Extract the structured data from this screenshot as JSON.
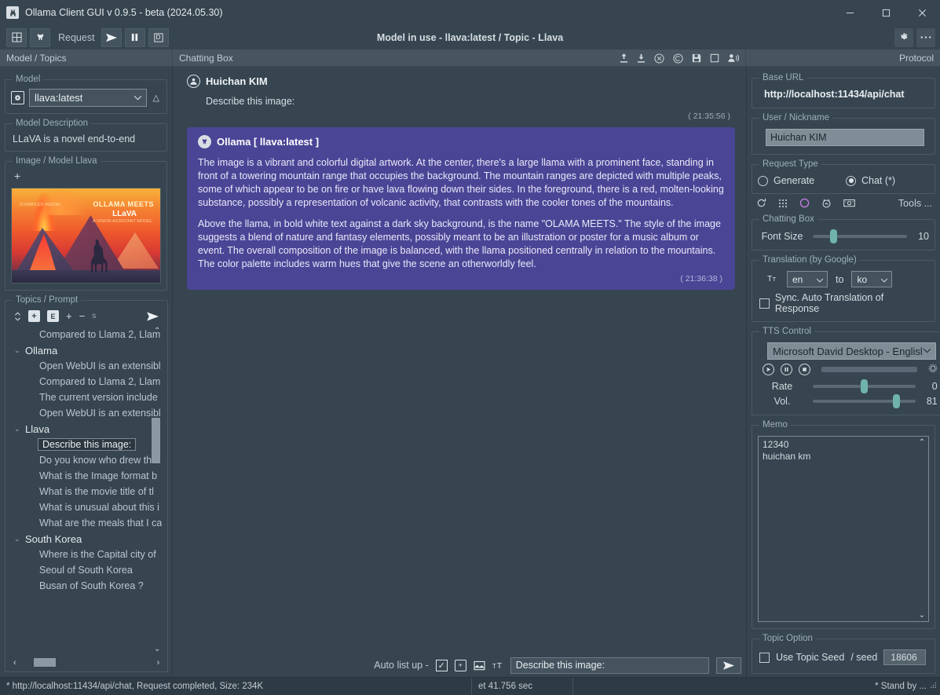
{
  "window": {
    "title": "Ollama Client GUI v 0.9.5 - beta (2024.05.30)",
    "app_icon": "llama-icon",
    "minimize": "−",
    "maximize": "□",
    "close": "✕"
  },
  "toolbar": {
    "grid_button": "grid-icon",
    "llama_button": "llama-icon",
    "request_label": "Request",
    "send_icon": "send-icon",
    "pause_icon": "pause-icon",
    "d_icon": "D",
    "center_title": "Model in use - llava:latest / Topic - Llava",
    "settings_icon": "gear-icon",
    "more_icon": "more-icon"
  },
  "header": {
    "left_label": "Model / Topics",
    "mid_label": "Chatting Box",
    "right_label": "Protocol",
    "mid_icons": [
      "upload-icon",
      "download-icon",
      "clear-icon",
      "copy-icon",
      "save-icon",
      "window-icon",
      "user-speak-icon"
    ]
  },
  "left_panel": {
    "model": {
      "legend": "Model",
      "icon": "model-icon",
      "value": "llava:latest",
      "caret": "⌄",
      "up_icon": "△"
    },
    "model_description": {
      "legend": "Model Description",
      "text": "LLaVA is a novel end-to-end"
    },
    "image": {
      "legend": "Image / Model Llava",
      "add_icon": "+",
      "thumb_title_1": "OLLAMA MEETS",
      "thumb_title_2": "LLaVA",
      "thumb_sub": "A VISION ASSISTANT MODEL",
      "thumb_corner": "(COMPILED INSIDE)"
    },
    "topics": {
      "legend": "Topics / Prompt",
      "buttons": [
        "sort-icon",
        "add-box-icon",
        "edit-box-icon",
        "plus-icon",
        "minus-icon",
        "s-icon",
        "send-icon"
      ],
      "tree": [
        {
          "indent": 1,
          "label": "Compared to Llama 2, Llam",
          "caret": "",
          "selected": false
        },
        {
          "indent": 0,
          "label": "Ollama",
          "caret": "⌄",
          "selected": false
        },
        {
          "indent": 1,
          "label": "Open WebUI is an extensibl",
          "caret": "",
          "selected": false
        },
        {
          "indent": 1,
          "label": "Compared to Llama 2, Llam",
          "caret": "",
          "selected": false
        },
        {
          "indent": 1,
          "label": "The current version include",
          "caret": "",
          "selected": false
        },
        {
          "indent": 1,
          "label": "Open WebUI is an extensibl",
          "caret": "",
          "selected": false
        },
        {
          "indent": 0,
          "label": "Llava",
          "caret": "⌄",
          "selected": false
        },
        {
          "indent": 1,
          "label": "Describe this image:",
          "caret": "",
          "selected": true
        },
        {
          "indent": 1,
          "label": "Do you know who drew this",
          "caret": "",
          "selected": false
        },
        {
          "indent": 1,
          "label": "What is the Image format b",
          "caret": "",
          "selected": false
        },
        {
          "indent": 1,
          "label": "What is the movie title of  tl",
          "caret": "",
          "selected": false
        },
        {
          "indent": 1,
          "label": "What is unusual about this i",
          "caret": "",
          "selected": false
        },
        {
          "indent": 1,
          "label": "What are the meals that I ca",
          "caret": "",
          "selected": false
        },
        {
          "indent": 0,
          "label": "South Korea",
          "caret": "⌄",
          "selected": false
        },
        {
          "indent": 1,
          "label": "Where is the Capital city of",
          "caret": "",
          "selected": false
        },
        {
          "indent": 1,
          "label": "Seoul of South Korea",
          "caret": "",
          "selected": false
        },
        {
          "indent": 1,
          "label": "Busan of South Korea ?",
          "caret": "",
          "selected": false
        }
      ],
      "scroll_up": "⌃",
      "scroll_down": "⌄",
      "hscroll_left": "‹",
      "hscroll_right": "›"
    }
  },
  "chat": {
    "user": {
      "avatar_icon": "user-circle-icon",
      "name": "Huichan KIM",
      "message": "Describe this image:",
      "timestamp": "( 21:35:56 )"
    },
    "assistant": {
      "avatar_icon": "llama-avatar-icon",
      "name": "Ollama [ llava:latest ]",
      "paragraphs": [
        "The image is a vibrant and colorful digital artwork. At the center, there's a large llama with a prominent face, standing in front of a towering mountain range that occupies the background. The mountain ranges are depicted with multiple peaks, some of which appear to be on fire or have lava flowing down their sides. In the foreground, there is a red, molten-looking substance, possibly a representation of volcanic activity, that contrasts with the cooler tones of the mountains.",
        "Above the llama, in bold white text against a dark sky background, is the name \"OLAMA MEETS.\" The style of the image suggests a blend of nature and fantasy elements, possibly meant to be an illustration or poster for a music album or event. The overall composition of the image is balanced, with the llama positioned centrally in relation to the mountains. The color palette includes warm hues that give the scene an otherworldly feel."
      ],
      "timestamp": "( 21:36:38 )",
      "bubble_color": "#4b4596"
    }
  },
  "input_bar": {
    "auto_list_label": "Auto list up  -",
    "checkbox_checked": true,
    "check_glyph": "✓",
    "buttons": [
      "add-image-icon",
      "picture-icon",
      "font-size-icon"
    ],
    "prompt_value": "Describe this image:",
    "prompt_placeholder": "",
    "send_icon": "send-icon"
  },
  "right_panel": {
    "base_url": {
      "legend": "Base URL",
      "value": "http://localhost:11434/api/chat"
    },
    "user_nickname": {
      "legend": "User / Nickname",
      "value": "Huichan KIM"
    },
    "request_type": {
      "legend": "Request Type",
      "options": [
        {
          "label": "Generate",
          "selected": false
        },
        {
          "label": "Chat (*)",
          "selected": true
        }
      ]
    },
    "tools_row": {
      "icons": [
        "refresh-icon",
        "grid-dots-icon",
        "circle-icon",
        "timer-icon",
        "camera-icon"
      ],
      "label": "Tools ...",
      "circle_color": "#c57de0"
    },
    "chatting_box": {
      "legend": "Chatting Box",
      "font_size_label": "Font Size",
      "font_size_value": "10",
      "font_size_percent": 22
    },
    "translation": {
      "legend": "Translation (by Google)",
      "icon": "translate-icon",
      "from": "en",
      "to_label": "to",
      "to": "ko",
      "sync_label": "Sync. Auto Translation of Response",
      "sync_checked": false
    },
    "tts": {
      "legend": "TTS Control",
      "voice": "Microsoft David Desktop - Englisl",
      "play_icon": "play-icon",
      "pause_icon": "pause-icon",
      "stop_icon": "stop-icon",
      "gear_icon": "gear-icon",
      "rate_label": "Rate",
      "rate_value": "0",
      "rate_percent": 50,
      "vol_label": "Vol.",
      "vol_value": "81",
      "vol_percent": 81
    },
    "memo": {
      "legend": "Memo",
      "lines": [
        "12340",
        "huichan km"
      ],
      "scroll_up": "⌃",
      "scroll_down": "⌄"
    },
    "topic_option": {
      "legend": "Topic Option",
      "use_seed_label": "Use Topic Seed",
      "use_seed_checked": false,
      "seed_label": "/ seed",
      "seed_value": "18606"
    }
  },
  "status_bar": {
    "left": "* http://localhost:11434/api/chat, Request completed, Size: 234K",
    "middle": "et 41.756 sec",
    "right": "* Stand by ...",
    "grip": "grip-icon"
  }
}
